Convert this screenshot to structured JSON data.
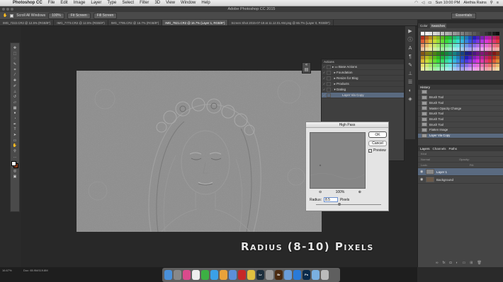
{
  "menubar": {
    "app": "Photoshop CC",
    "items": [
      "File",
      "Edit",
      "Image",
      "Layer",
      "Type",
      "Select",
      "Filter",
      "3D",
      "View",
      "Window",
      "Help"
    ],
    "clock": "Sun 10:00 PM",
    "user": "Alethia Rains"
  },
  "window_title": "Adobe Photoshop CC 2015",
  "options_bar": {
    "scroll_all": "Scroll All Windows",
    "zoom": "100%",
    "fit_screen": "Fit Screen",
    "fill_screen": "Fill Screen",
    "workspace": "Essentials"
  },
  "doc_tabs": [
    "IMG_7222.CR2 @ 12.5% (RGB/8*)",
    "IMG_7773.CR2 @ 12.5% (RGB/8*)",
    "IMG_7795.CR2 @ 16.7% (RGB/8*)",
    "IMG_7821.CR2 @ 16.7% (Layer 1, RGB/8*)",
    "Screen Shot 2015-07-18 at 11.12.01 AM.png @ 66.7% (Layer 0, RGB/8*)"
  ],
  "actions_panel": {
    "title": "Actions",
    "rows": [
      {
        "label": "Base Actions",
        "indent": 0,
        "selected": false
      },
      {
        "label": "Foundation",
        "indent": 1,
        "selected": false
      },
      {
        "label": "Resize for Blog",
        "indent": 1,
        "selected": false
      },
      {
        "label": "Products",
        "indent": 1,
        "selected": false
      },
      {
        "label": "Dating",
        "indent": 1,
        "selected": false
      },
      {
        "label": "Layer Via Copy",
        "indent": 2,
        "selected": true
      }
    ]
  },
  "high_pass": {
    "title": "High Pass",
    "ok": "OK",
    "cancel": "Cancel",
    "preview_label": "Preview",
    "preview_checked": true,
    "zoom_out": "⊖",
    "zoom_level": "100%",
    "zoom_in": "⊕",
    "radius_label": "Radius:",
    "radius_value": "8.5",
    "radius_unit": "Pixels"
  },
  "color_panel": {
    "tabs": [
      "Color",
      "Swatches"
    ]
  },
  "history_panel": {
    "title": "History",
    "rows": [
      {
        "label": "",
        "selected": false
      },
      {
        "label": "Brush Tool",
        "selected": false
      },
      {
        "label": "Brush Tool",
        "selected": false
      },
      {
        "label": "Master Opacity Change",
        "selected": false
      },
      {
        "label": "Brush Tool",
        "selected": false
      },
      {
        "label": "Brush Tool",
        "selected": false
      },
      {
        "label": "Brush Tool",
        "selected": false
      },
      {
        "label": "Flatten Image",
        "selected": false
      },
      {
        "label": "Layer Via Copy",
        "selected": true
      }
    ]
  },
  "layers_panel": {
    "tabs": [
      "Layers",
      "Channels",
      "Paths"
    ],
    "kind": "Kind",
    "mode": "Normal",
    "opacity_label": "Opacity:",
    "lock_label": "Lock:",
    "fill_label": "Fill:",
    "layers": [
      {
        "name": "Layer 1",
        "selected": true
      },
      {
        "name": "Background",
        "selected": false
      }
    ]
  },
  "status": {
    "zoom": "16.67%",
    "doc": "Doc: 65.9M/119.8M"
  },
  "caption": "Radius (8-10) Pixels",
  "dock_apps": [
    {
      "name": "Finder",
      "color": "#4a90d9",
      "label": ""
    },
    {
      "name": "Launchpad",
      "color": "#888",
      "label": ""
    },
    {
      "name": "iTunes",
      "color": "#d94a8c",
      "label": ""
    },
    {
      "name": "Calendar",
      "color": "#eee",
      "label": ""
    },
    {
      "name": "FaceTime",
      "color": "#3cb043",
      "label": ""
    },
    {
      "name": "Messages",
      "color": "#3aa0e8",
      "label": ""
    },
    {
      "name": "Photos",
      "color": "#e8a23a",
      "label": ""
    },
    {
      "name": "Mail",
      "color": "#5b8fd9",
      "label": ""
    },
    {
      "name": "Acrobat",
      "color": "#c62828",
      "label": ""
    },
    {
      "name": "Chrome",
      "color": "#e0c040",
      "label": ""
    },
    {
      "name": "Lightroom",
      "color": "#1e2f3c",
      "label": "Lr"
    },
    {
      "name": "iPhoto",
      "color": "#999",
      "label": ""
    },
    {
      "name": "Bridge",
      "color": "#4a2a10",
      "label": "Br"
    },
    {
      "name": "Preview",
      "color": "#6a9cd8",
      "label": ""
    },
    {
      "name": "Safari",
      "color": "#2a7ad8",
      "label": ""
    },
    {
      "name": "Photoshop",
      "color": "#0a2a4a",
      "label": "Ps"
    },
    {
      "name": "Downloads",
      "color": "#7ab0e0",
      "label": ""
    },
    {
      "name": "Trash",
      "color": "#bbb",
      "label": ""
    }
  ],
  "colors": {
    "foreground": "#ffffff",
    "background": "#8b3d1c",
    "selection": "#5a6a80"
  }
}
